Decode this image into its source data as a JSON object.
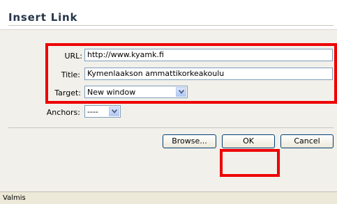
{
  "dialog": {
    "title": "Insert Link"
  },
  "form": {
    "url_label": "URL:",
    "url_value": "http://www.kyamk.fi",
    "title_label": "Title:",
    "title_value": "Kymenlaakson ammattikorkeakoulu",
    "target_label": "Target:",
    "target_value": "New window",
    "anchors_label": "Anchors:",
    "anchors_value": "----"
  },
  "buttons": {
    "browse": "Browse...",
    "ok": "OK",
    "cancel": "Cancel"
  },
  "status": {
    "text": "Valmis"
  },
  "colors": {
    "highlight": "#ee0000",
    "title_text": "#26364a",
    "dialog_bg": "#f1f0ea"
  }
}
